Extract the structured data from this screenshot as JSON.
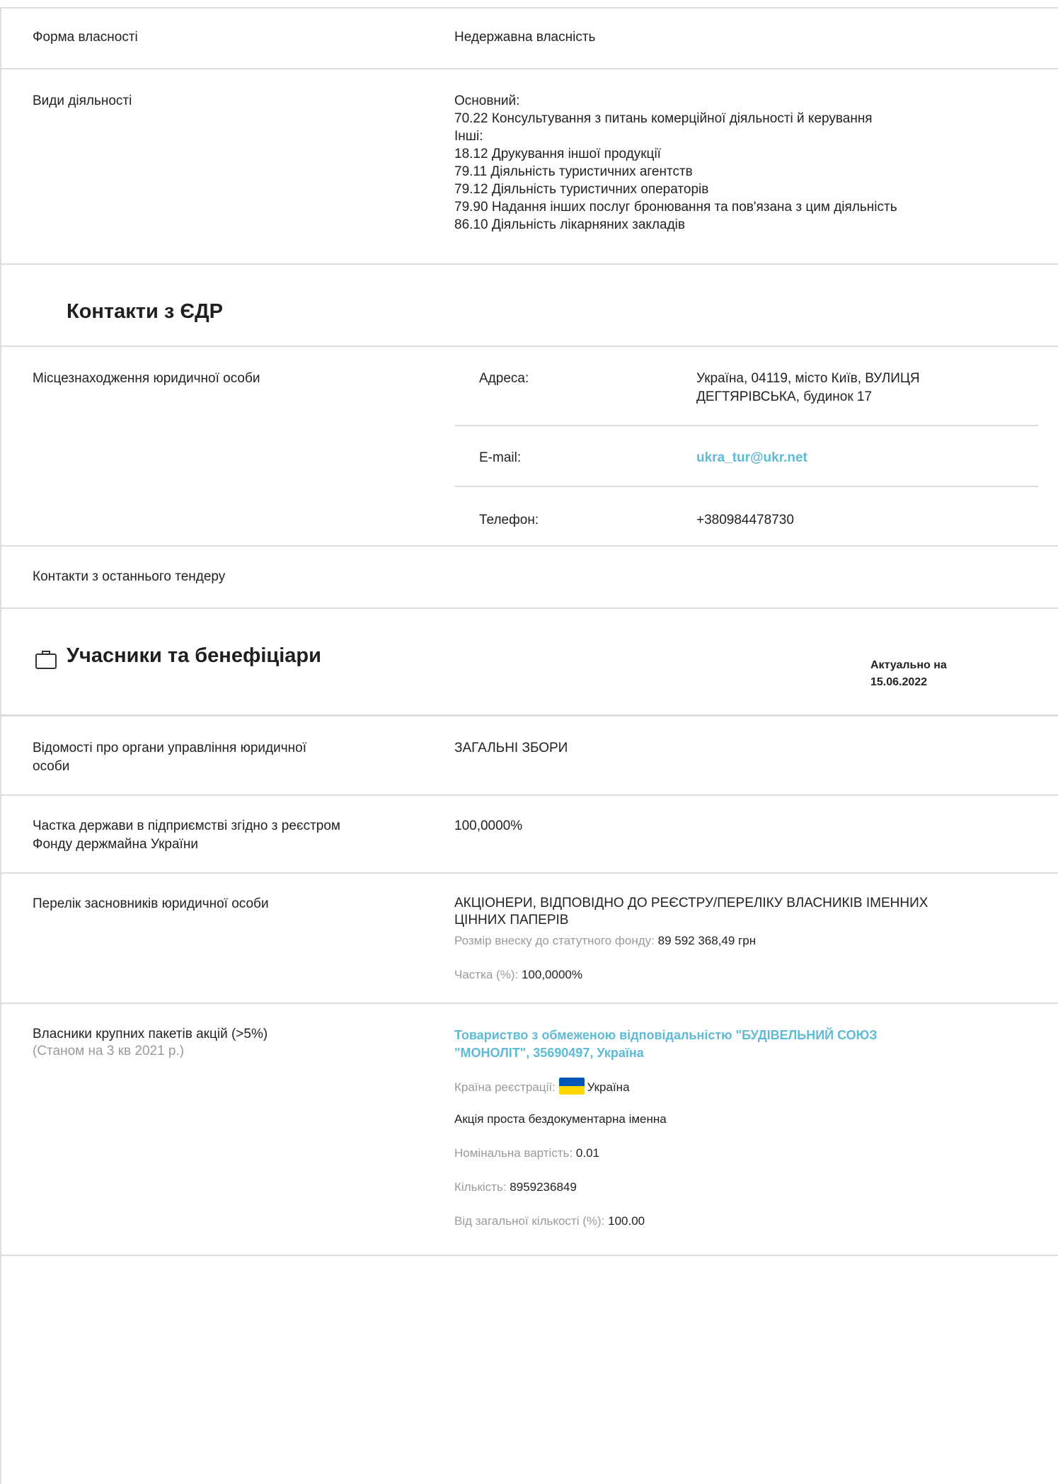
{
  "ownership": {
    "label": "Форма власності",
    "value": "Недержавна власність"
  },
  "activities": {
    "label": "Види діяльності",
    "lines": [
      "Основний:",
      "70.22 Консультування з питань комерційної діяльності й керування",
      "Інші:",
      "18.12 Друкування іншої продукції",
      "79.11 Діяльність туристичних агентств",
      "79.12 Діяльність туристичних операторів",
      "79.90 Надання інших послуг бронювання та пов'язана з цим діяльність",
      "86.10 Діяльність лікарняних закладів"
    ]
  },
  "contacts_edr": {
    "title": "Контакти з ЄДР",
    "location_label": "Місцезнаходження юридичної особи",
    "address_label": "Адреса:",
    "address_line1": "Україна, 04119, місто Київ, ВУЛИЦЯ",
    "address_line2": "ДЕГТЯРІВСЬКА, будинок 17",
    "email_label": "E-mail:",
    "email": "ukra_tur@ukr.net",
    "phone_label": "Телефон:",
    "phone": "+380984478730"
  },
  "tender_contacts": {
    "label": "Контакти з останнього тендеру"
  },
  "participants": {
    "title": "Учасники та бенефіціари",
    "actual_label": "Актуально на",
    "actual_date": "15.06.2022",
    "icon": "briefcase-icon"
  },
  "management": {
    "label_line1": "Відомості про органи управління юридичної",
    "label_line2": "особи",
    "value": "ЗАГАЛЬНІ ЗБОРИ"
  },
  "state_share": {
    "label_line1": "Частка держави в підприємстві згідно з реєстром",
    "label_line2": "Фонду держмайна України",
    "value": "100,0000%"
  },
  "founders": {
    "label": "Перелік засновників юридичної особи",
    "name_line1": "АКЦІОНЕРИ, ВІДПОВІДНО ДО РЕЄСТРУ/ПЕРЕЛІКУ ВЛАСНИКІВ ІМЕННИХ",
    "name_line2": "ЦІННИХ ПАПЕРІВ",
    "capital_label": "Розмір внеску до статутного фонду:",
    "capital_value": "89 592 368,49 грн",
    "share_label": "Частка (%):",
    "share_value": "100,0000%"
  },
  "shareholders": {
    "label": "Власники крупних пакетів акцій (>5%)",
    "as_of": "(Станом на 3 кв 2021 р.)",
    "company_line1": "Товариство з обмеженою відповідальністю \"БУДІВЕЛЬНИЙ СОЮЗ",
    "company_line2": "\"МОНОЛІТ\", 35690497, Україна",
    "country_label": "Країна реєстрації:",
    "country_value": "Україна",
    "flag_colors": [
      "#0057b7",
      "#ffd700"
    ],
    "share_type": "Акція проста бездокументарна іменна",
    "nominal_label": "Номінальна вартість:",
    "nominal_value": "0.01",
    "quantity_label": "Кількість:",
    "quantity_value": "8959236849",
    "percent_label": "Від загальної кількості (%):",
    "percent_value": "100.00"
  }
}
